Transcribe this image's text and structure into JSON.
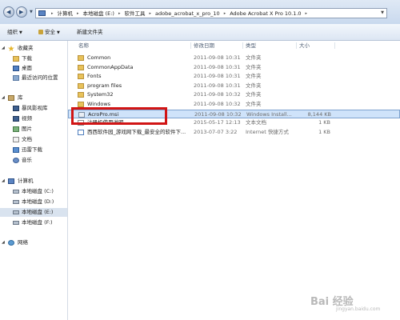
{
  "address_bar": {
    "crumbs": [
      "计算机",
      "本地磁盘 (E:)",
      "软件工具",
      "adobe_acrobat_x_pro_10",
      "Adobe Acrobat X Pro 10.1.0"
    ]
  },
  "toolbar": {
    "organize_label": "组织",
    "security_label": "安全",
    "new_folder_label": "新建文件夹"
  },
  "sidebar": {
    "favorites_label": "收藏夹",
    "favorites": [
      "下载",
      "桌面",
      "最近访问的位置"
    ],
    "libraries_label": "库",
    "libraries": [
      "暴风影视库",
      "视频",
      "图片",
      "文档",
      "迅雷下载",
      "音乐"
    ],
    "computer_label": "计算机",
    "drives": [
      "本地磁盘 (C:)",
      "本地磁盘 (D:)",
      "本地磁盘 (E:)",
      "本地磁盘 (F:)"
    ],
    "network_label": "网络"
  },
  "columns": {
    "name": "名称",
    "date": "修改日期",
    "type": "类型",
    "size": "大小"
  },
  "files": [
    {
      "name": "Common",
      "date": "2011-09-08 10:31",
      "type": "文件夹",
      "size": "",
      "icon": "folder-icon"
    },
    {
      "name": "CommonAppData",
      "date": "2011-09-08 10:31",
      "type": "文件夹",
      "size": "",
      "icon": "folder-icon"
    },
    {
      "name": "Fonts",
      "date": "2011-09-08 10:31",
      "type": "文件夹",
      "size": "",
      "icon": "folder-icon"
    },
    {
      "name": "program files",
      "date": "2011-09-08 10:31",
      "type": "文件夹",
      "size": "",
      "icon": "folder-icon"
    },
    {
      "name": "System32",
      "date": "2011-09-08 10:32",
      "type": "文件夹",
      "size": "",
      "icon": "folder-icon"
    },
    {
      "name": "Windows",
      "date": "2011-09-08 10:32",
      "type": "文件夹",
      "size": "",
      "icon": "folder-icon"
    },
    {
      "name": "AcroPro.msi",
      "date": "2011-09-08 10:32",
      "type": "Windows Install...",
      "size": "8,144 KB",
      "icon": "installer-icon"
    },
    {
      "name": "注册机使用说明",
      "date": "2015-05-17 12:13",
      "type": "文本文档",
      "size": "1 KB",
      "icon": "text-document-icon"
    },
    {
      "name": "西西软件园_游戏网下载_最安全的软件下...",
      "date": "2013-07-07 3:22",
      "type": "Internet 快捷方式",
      "size": "1 KB",
      "icon": "internet-shortcut-icon"
    }
  ],
  "watermark": {
    "main": "Bai 经验",
    "sub": "jingyan.baidu.com"
  },
  "colors": {
    "highlight_border": "#d11515",
    "selection_fill": "#cfe3fa",
    "sidebar_selected": "#d9e3ef"
  }
}
